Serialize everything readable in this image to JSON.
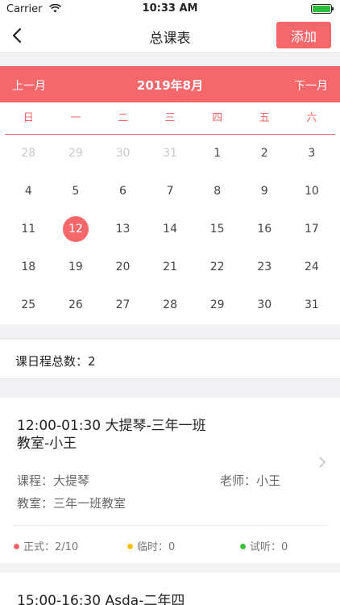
{
  "status_bar": {
    "carrier": "Carrier",
    "time": "10:33 AM",
    "battery_percent": 100
  },
  "nav": {
    "title": "总课表",
    "add_label": "添加"
  },
  "calendar": {
    "prev_label": "上一月",
    "next_label": "下一月",
    "month_title": "2019年8月",
    "weekdays": [
      "日",
      "一",
      "二",
      "三",
      "四",
      "五",
      "六"
    ],
    "weeks": [
      [
        "28",
        "29",
        "30",
        "31",
        "1",
        "2",
        "3"
      ],
      [
        "4",
        "5",
        "6",
        "7",
        "8",
        "9",
        "10"
      ],
      [
        "11",
        "12",
        "13",
        "14",
        "15",
        "16",
        "17"
      ],
      [
        "18",
        "19",
        "20",
        "21",
        "22",
        "23",
        "24"
      ],
      [
        "25",
        "26",
        "27",
        "28",
        "29",
        "30",
        "31"
      ]
    ],
    "selected_day": "12",
    "accent_color": "#f4676b"
  },
  "summary": {
    "text": "课日程总数：2"
  },
  "schedules": [
    {
      "title": "12:00-01:30 大提琴-三年一班教室-小王",
      "course": "课程：大提琴",
      "teacher": "老师：小王",
      "room": "教室：三年一班教室",
      "formal": "正式：2/10",
      "temporary": "临时：0",
      "trial": "试听：0"
    },
    {
      "title": "15:00-16:30 Asda-二年四"
    }
  ],
  "colors": {
    "formal_dot": "#f4676b",
    "temporary_dot": "#f5c21b",
    "trial_dot": "#3cbf3c"
  }
}
